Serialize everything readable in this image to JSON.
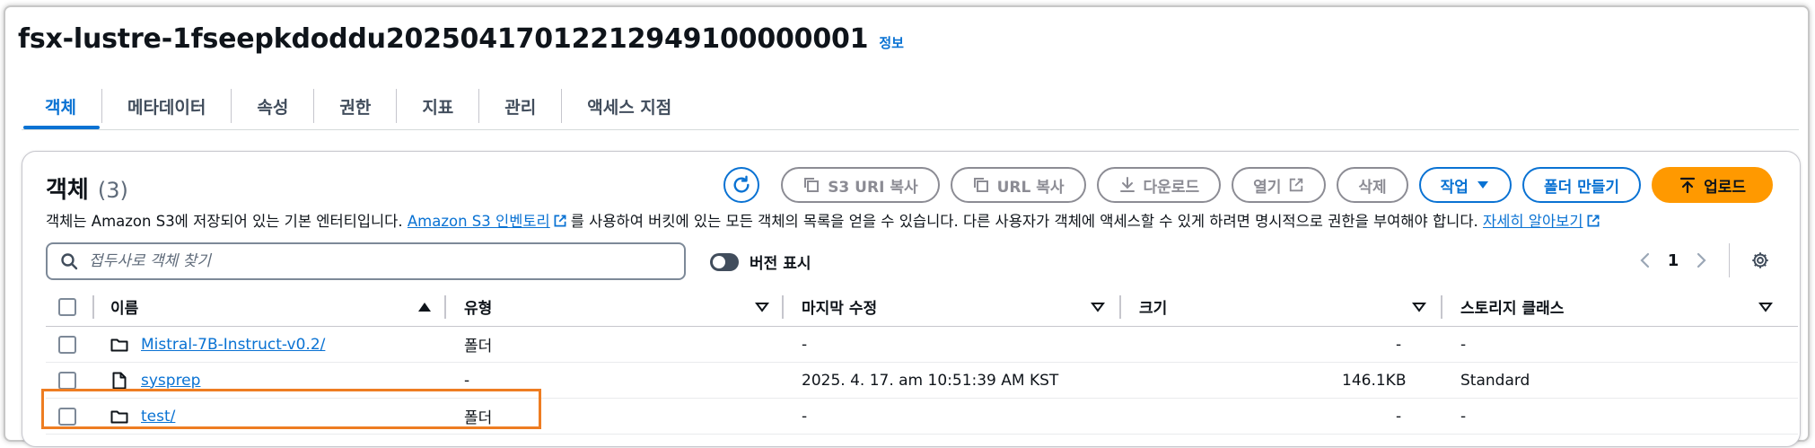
{
  "bucket": {
    "title": "fsx-lustre-1fseepkdoddu20250417012212949100000001",
    "info_label": "정보"
  },
  "tabs": [
    {
      "label": "객체",
      "active": true
    },
    {
      "label": "메타데이터"
    },
    {
      "label": "속성"
    },
    {
      "label": "권한"
    },
    {
      "label": "지표"
    },
    {
      "label": "관리"
    },
    {
      "label": "액세스 지점"
    }
  ],
  "objects_panel": {
    "title": "객체",
    "count": "(3)",
    "toolbar": {
      "refresh_icon": "refresh-icon",
      "copy_s3_uri": "S3 URI 복사",
      "copy_url": "URL 복사",
      "download": "다운로드",
      "open": "열기",
      "delete": "삭제",
      "actions": "작업",
      "create_folder": "폴더 만들기",
      "upload": "업로드"
    },
    "description": {
      "part1": "객체는 Amazon S3에 저장되어 있는 기본 엔터티입니다.",
      "link1": "Amazon S3 인벤토리",
      "part2": "를 사용하여 버킷에 있는 모든 객체의 목록을 얻을 수 있습니다. 다른 사용자가 객체에 액세스할 수 있게 하려면 명시적으로 권한을 부여해야 합니다.",
      "link2": "자세히 알아보기"
    },
    "search_placeholder": "접두사로 객체 찾기",
    "show_versions_label": "버전 표시",
    "pagination": {
      "current_page": "1"
    },
    "columns": {
      "name": "이름",
      "type": "유형",
      "last_modified": "마지막 수정",
      "size": "크기",
      "storage_class": "스토리지 클래스"
    },
    "rows": [
      {
        "icon": "folder-icon",
        "name": "Mistral-7B-Instruct-v0.2/",
        "type": "폴더",
        "last_modified": "-",
        "size": "-",
        "storage_class": "-"
      },
      {
        "icon": "file-icon",
        "name": "sysprep",
        "type": "-",
        "last_modified": "2025. 4. 17. am 10:51:39 AM KST",
        "size": "146.1KB",
        "storage_class": "Standard"
      },
      {
        "icon": "folder-icon",
        "name": "test/",
        "type": "폴더",
        "last_modified": "-",
        "size": "-",
        "storage_class": "-"
      }
    ]
  },
  "colors": {
    "accent": "#0972d3",
    "upload_button": "#ff9900",
    "highlight_box": "#ee7d22"
  }
}
